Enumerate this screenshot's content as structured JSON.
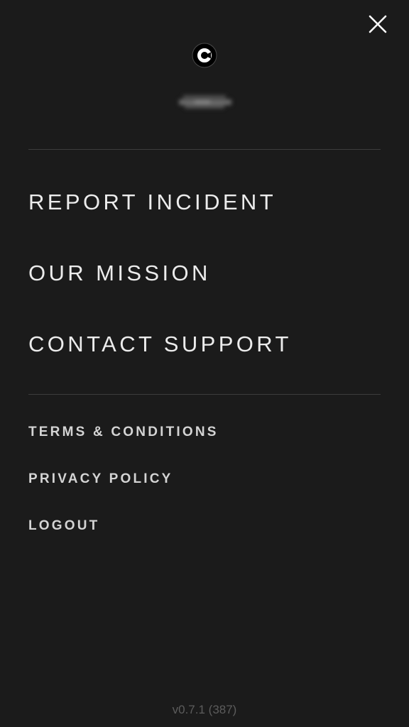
{
  "header": {
    "close_icon": "close-icon",
    "logo_icon": "c-logo-icon",
    "username_redacted": true
  },
  "main_menu": {
    "items": [
      {
        "label": "REPORT INCIDENT"
      },
      {
        "label": "OUR MISSION"
      },
      {
        "label": "CONTACT SUPPORT"
      }
    ]
  },
  "secondary_menu": {
    "items": [
      {
        "label": "TERMS & CONDITIONS"
      },
      {
        "label": "PRIVACY POLICY"
      },
      {
        "label": "LOGOUT"
      }
    ]
  },
  "footer": {
    "version": "v0.7.1 (387)"
  },
  "colors": {
    "background": "#1b1b1b",
    "text": "#ececec",
    "divider": "#3d3d3d",
    "version_text": "#5c5c5c"
  }
}
